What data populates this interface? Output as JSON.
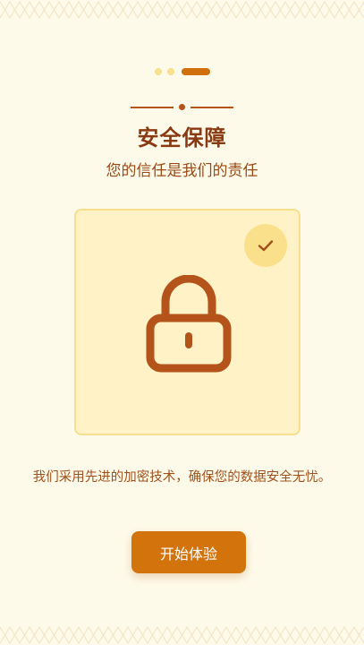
{
  "pager": {
    "total": 3,
    "active_index": 3
  },
  "header": {
    "title": "安全保障",
    "subtitle": "您的信任是我们的责任"
  },
  "illustration": {
    "main_icon": "lock-icon",
    "badge_icon": "check-icon"
  },
  "body": {
    "description": "我们采用先进的加密技术，确保您的数据安全无忧。"
  },
  "cta": {
    "label": "开始体验"
  },
  "colors": {
    "background": "#fefaea",
    "accent": "#d2730c",
    "title": "#8a3a12",
    "card_fill": "#fef2c6",
    "card_border": "#f7df8d",
    "badge": "#fbe08c",
    "icon_stroke": "#b4531a"
  }
}
